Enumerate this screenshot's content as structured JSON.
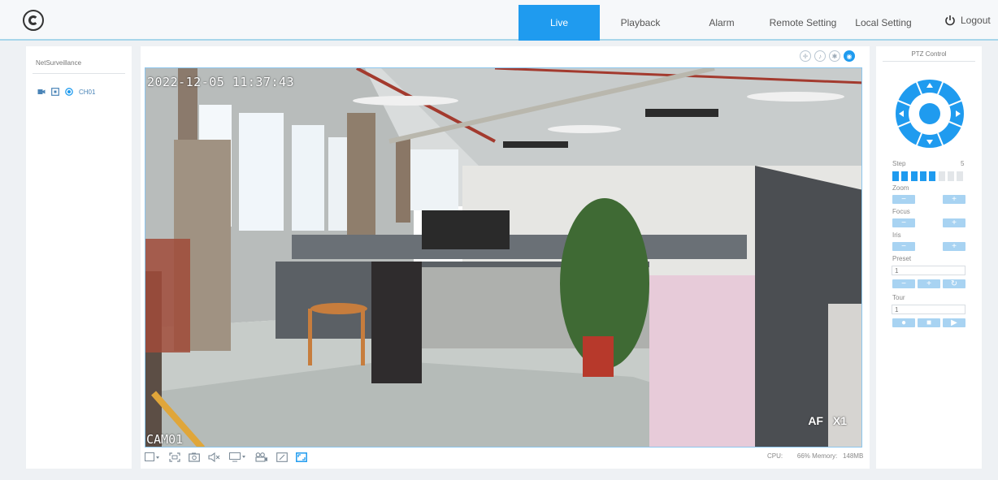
{
  "nav": {
    "items": [
      {
        "label": "Live",
        "active": true
      },
      {
        "label": "Playback",
        "active": false
      },
      {
        "label": "Alarm",
        "active": false
      },
      {
        "label": "Remote Setting",
        "active": false
      },
      {
        "label": "Local Setting",
        "active": false
      }
    ],
    "logout_label": "Logout"
  },
  "sidebar": {
    "title": "NetSurveillance",
    "channel_label": "CH01"
  },
  "video": {
    "osd_time": "2022-12-05 11:37:43",
    "osd_camera": "CAM01",
    "osd_af": "AF X1",
    "top_tool_icons": [
      "ptz-direction-icon",
      "microphone-icon",
      "fisheye-icon",
      "ptz-panel-icon"
    ],
    "bottom_tool_icons": [
      "layout-icon",
      "fullscreen-icon",
      "snapshot-icon",
      "mute-icon",
      "stream-icon",
      "record-icon",
      "digital-zoom-icon",
      "ptz-toggle-icon"
    ]
  },
  "status": {
    "cpu_label": "CPU:",
    "cpu_value": "66%",
    "memory_label": "Memory:",
    "memory_value": "148MB"
  },
  "ptz": {
    "title": "PTZ Control",
    "step_label": "Step",
    "step_value": "5",
    "step_level": 5,
    "step_max": 8,
    "zoom_label": "Zoom",
    "focus_label": "Focus",
    "iris_label": "Iris",
    "preset_label": "Preset",
    "preset_value": "1",
    "tour_label": "Tour",
    "tour_value": "1",
    "minus": "−",
    "plus": "+",
    "refresh": "↻",
    "record": "●",
    "stop": "■",
    "play": "▶"
  },
  "colors": {
    "accent": "#1f9bef",
    "accent_light": "#a8d3f2",
    "topbar_border": "#a7d6ea"
  }
}
